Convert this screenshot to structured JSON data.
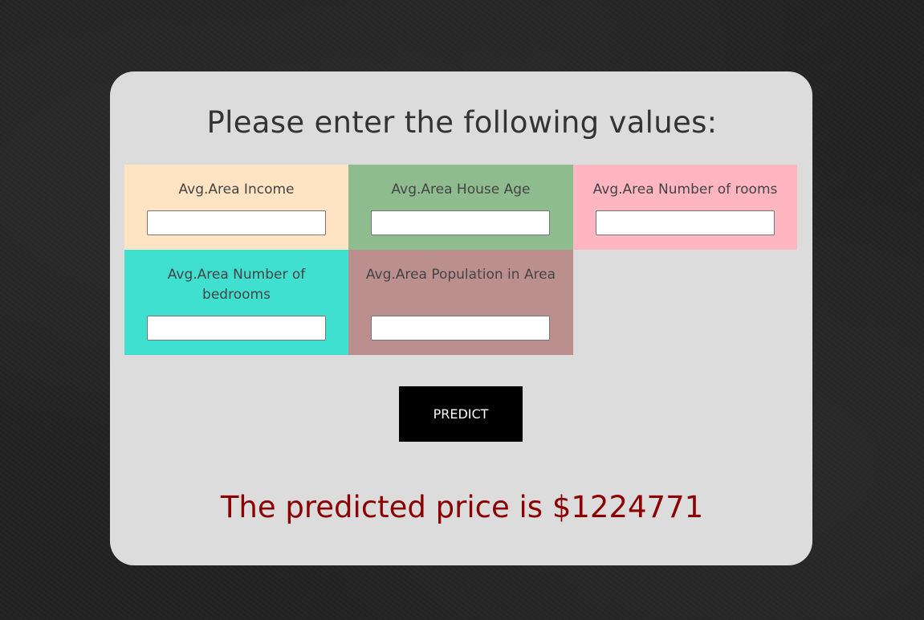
{
  "form": {
    "heading": "Please enter the following values:",
    "fields": [
      {
        "label": "Avg.Area Income",
        "value": "",
        "color": "#ffe4c4"
      },
      {
        "label": "Avg.Area House Age",
        "value": "",
        "color": "#8fbc8f"
      },
      {
        "label": "Avg.Area Number of rooms",
        "value": "",
        "color": "#ffb6c1"
      },
      {
        "label": "Avg.Area Number of bedrooms",
        "value": "",
        "color": "#40e0d0"
      },
      {
        "label": "Avg.Area Population in Area",
        "value": "",
        "color": "#bc8f8f"
      }
    ],
    "predict_label": "PREDICT",
    "result_text": "The predicted price is $1224771"
  },
  "colors": {
    "background": "#232323",
    "card": "#dcdcdc",
    "button": "#000000",
    "result": "#8b0000"
  }
}
